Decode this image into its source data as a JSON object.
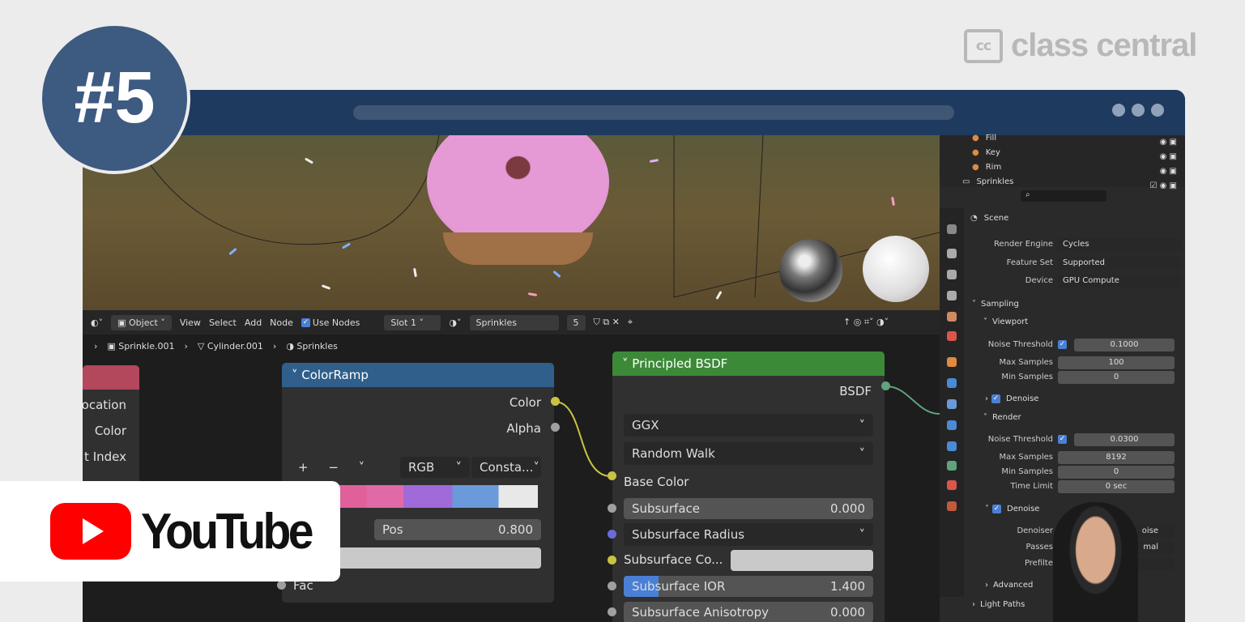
{
  "badge": {
    "text": "#5"
  },
  "brand": {
    "icon_text": "cc",
    "name": "class central"
  },
  "youtube": {
    "label": "YouTube"
  },
  "header": {
    "mode": "Object",
    "menus": [
      "View",
      "Select",
      "Add",
      "Node"
    ],
    "use_nodes": "Use Nodes",
    "slot": "Slot 1",
    "material": "Sprinkles",
    "users": "5"
  },
  "breadcrumb": [
    "Sprinkle.001",
    "Cylinder.001",
    "Sprinkles"
  ],
  "left_node": {
    "outputs": [
      "ocation",
      "Color",
      "t Index"
    ]
  },
  "colorramp": {
    "title": "ColorRamp",
    "outputs": [
      "Color",
      "Alpha"
    ],
    "mode": "RGB",
    "interp": "Consta...",
    "pos_label": "Pos",
    "pos_value": "0.800",
    "input": "Fac"
  },
  "bsdf": {
    "title": "Principled BSDF",
    "output": "BSDF",
    "distribution": "GGX",
    "subsurface_method": "Random Walk",
    "base_color": "Base Color",
    "subsurface": {
      "label": "Subsurface",
      "value": "0.000"
    },
    "subsurface_radius": "Subsurface Radius",
    "subsurface_color": "Subsurface Co...",
    "subsurface_ior": {
      "label": "Subsurface IOR",
      "value": "1.400"
    },
    "subsurface_aniso": {
      "label": "Subsurface Anisotropy",
      "value": "0.000"
    }
  },
  "outliner": {
    "items": [
      "Fill",
      "Key",
      "Rim",
      "Sprinkles"
    ]
  },
  "properties": {
    "context": "Scene",
    "render_engine": {
      "label": "Render Engine",
      "value": "Cycles"
    },
    "feature_set": {
      "label": "Feature Set",
      "value": "Supported"
    },
    "device": {
      "label": "Device",
      "value": "GPU Compute"
    },
    "sampling": "Sampling",
    "viewport": {
      "title": "Viewport",
      "noise_threshold": {
        "label": "Noise Threshold",
        "value": "0.1000"
      },
      "max_samples": {
        "label": "Max Samples",
        "value": "100"
      },
      "min_samples": {
        "label": "Min Samples",
        "value": "0"
      },
      "denoise": "Denoise"
    },
    "render": {
      "title": "Render",
      "noise_threshold": {
        "label": "Noise Threshold",
        "value": "0.0300"
      },
      "max_samples": {
        "label": "Max Samples",
        "value": "8192"
      },
      "min_samples": {
        "label": "Min Samples",
        "value": "0"
      },
      "time_limit": {
        "label": "Time Limit",
        "value": "0 sec"
      },
      "denoise": "Denoise",
      "denoiser": {
        "label": "Denoiser",
        "value": "oise"
      },
      "passes": {
        "label": "Passes",
        "value": "mal"
      },
      "prefilter": {
        "label": "Prefilte"
      }
    },
    "advanced": "Advanced",
    "light_paths": "Light Paths"
  },
  "colors": {
    "accent": "#3d5a80",
    "colorramp_header": "#2f5f8a",
    "bsdf_header": "#3c8a38"
  }
}
